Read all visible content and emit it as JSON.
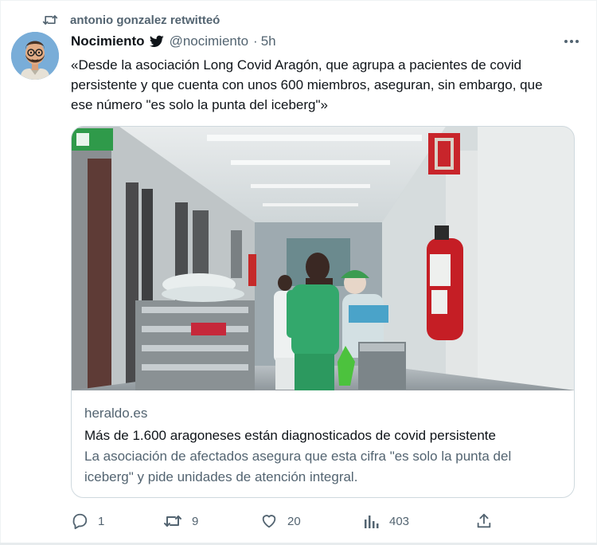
{
  "retweet": {
    "text": "antonio gonzalez retwitteó",
    "icon": "retweet-icon"
  },
  "tweet": {
    "author_name": "Nocimiento",
    "verified_icon": "twitter-bird-icon",
    "handle": "@nocimiento",
    "separator": "·",
    "time": "5h",
    "text": "«Desde la asociación Long Covid Aragón, que agrupa a pacientes de covid persistente y que cuenta con unos 600 miembros, aseguran, sin embargo, que ese número \"es solo la punta del iceberg\"»"
  },
  "card": {
    "domain": "heraldo.es",
    "title": "Más de 1.600 aragoneses están diagnosticados de covid persistente",
    "description": "La asociación de afectados asegura que esta cifra \"es solo la punta del iceberg\" y pide unidades de atención integral."
  },
  "actions": {
    "replies": "1",
    "retweets": "9",
    "likes": "20",
    "views": "403"
  },
  "colors": {
    "text_primary": "#0f1419",
    "text_secondary": "#536471",
    "border": "#cfd9de"
  }
}
